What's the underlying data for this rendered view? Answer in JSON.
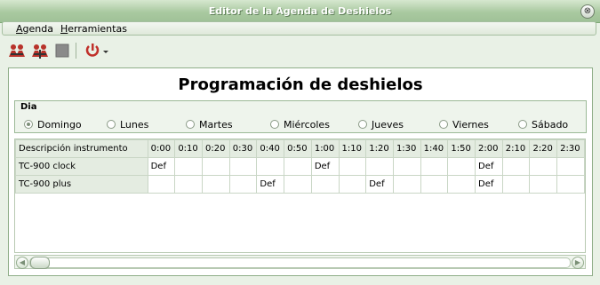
{
  "window": {
    "title": "Editor de la Agenda de Deshielos",
    "close_glyph": "⊗"
  },
  "menu": {
    "agenda": {
      "mnemonic": "A",
      "rest": "genda"
    },
    "herramientas": {
      "mnemonic": "H",
      "rest": "erramientas"
    }
  },
  "toolbar": {
    "icons": [
      "people-add-icon",
      "people-remove-icon",
      "stop-icon",
      "power-dropdown-icon"
    ]
  },
  "main": {
    "heading": "Programación de deshielos",
    "day_group": {
      "label": "Dia",
      "options": [
        "Domingo",
        "Lunes",
        "Martes",
        "Miércoles",
        "Jueves",
        "Viernes",
        "Sábado"
      ],
      "selected": "Domingo"
    },
    "table": {
      "headers": [
        "Descripción instrumento",
        "0:00",
        "0:10",
        "0:20",
        "0:30",
        "0:40",
        "0:50",
        "1:00",
        "1:10",
        "1:20",
        "1:30",
        "1:40",
        "1:50",
        "2:00",
        "2:10",
        "2:20",
        "2:30"
      ],
      "rows": [
        [
          "TC-900 clock",
          "Def",
          "",
          "",
          "",
          "",
          "",
          "Def",
          "",
          "",
          "",
          "",
          "",
          "Def",
          "",
          "",
          ""
        ],
        [
          "TC-900 plus",
          "",
          "",
          "",
          "",
          "Def",
          "",
          "",
          "",
          "Def",
          "",
          "",
          "",
          "Def",
          "",
          "",
          ""
        ]
      ]
    }
  },
  "colors": {
    "accent": "#a9c9a0",
    "toolbar_red": "#c0302a"
  }
}
